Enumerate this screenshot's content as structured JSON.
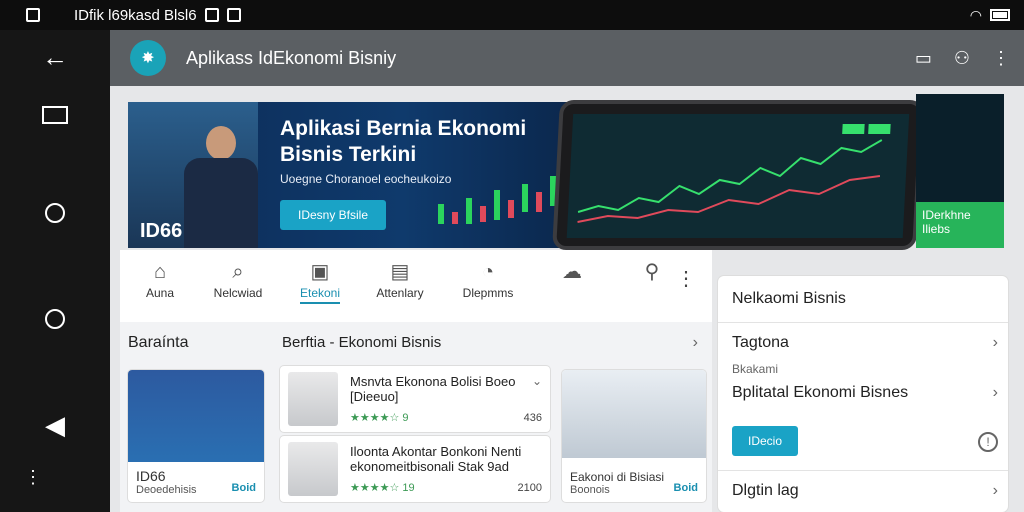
{
  "status_bar": {
    "title": "IDfik l69kasd Blsl6"
  },
  "app": {
    "title": "Aplikass IdEkonomi Bisniy"
  },
  "banner": {
    "title": "Aplikasi Bernia Ekonomi Bisnis Terkini",
    "subtitle": "Uoegne Choranoel eocheukoizo",
    "cta_label": "IDesny Bfsile",
    "brand": "ID66"
  },
  "side_promo": {
    "label": "IDerkhne Iliebs"
  },
  "tabs": [
    {
      "label": "Auna",
      "icon": "home-icon"
    },
    {
      "label": "Nelcwiad",
      "icon": "search-icon"
    },
    {
      "label": "Etekoni",
      "icon": "shop-icon",
      "active": true
    },
    {
      "label": "Attenlary",
      "icon": "chart-icon"
    },
    {
      "label": "Dlepmms",
      "icon": "chat-icon"
    },
    {
      "label": "",
      "icon": "cloud-icon"
    },
    {
      "label": "",
      "icon": "person-icon"
    }
  ],
  "sections": {
    "left_heading": "Baraínta",
    "middle_heading": "Berftia - Ekonomi Bisnis"
  },
  "cards": {
    "left_card": {
      "title": "ID66",
      "meta": "Deoedehisis",
      "badge": "Boid"
    },
    "right_card": {
      "title": "Eakonoi di Bisiasi",
      "meta": "Boonois",
      "badge": "Boid"
    }
  },
  "rows": [
    {
      "title": "Msnvta Ekonona Bolisi Boeo [Dieeuo]",
      "meta": "★★★★☆ 9",
      "num": "436"
    },
    {
      "title": "Iloonta Akontar Bonkoni Nenti ekonomeitbisonali Stak 9ad",
      "meta": "★★★★☆ 19",
      "num": "2100"
    }
  ],
  "right_panel": {
    "title": "Nelkaomi Bisnis",
    "item1": "Tagtona",
    "item1_sub": "Bkakami",
    "item2": "Bplitatal Ekonomi Bisnes",
    "button_label": "IDecio",
    "item3": "Dlgtin lag"
  },
  "colors": {
    "accent": "#1aa3c6",
    "appbar": "#5b5f63",
    "banner": "#0f3a6c",
    "promo_green": "#27b45a"
  }
}
